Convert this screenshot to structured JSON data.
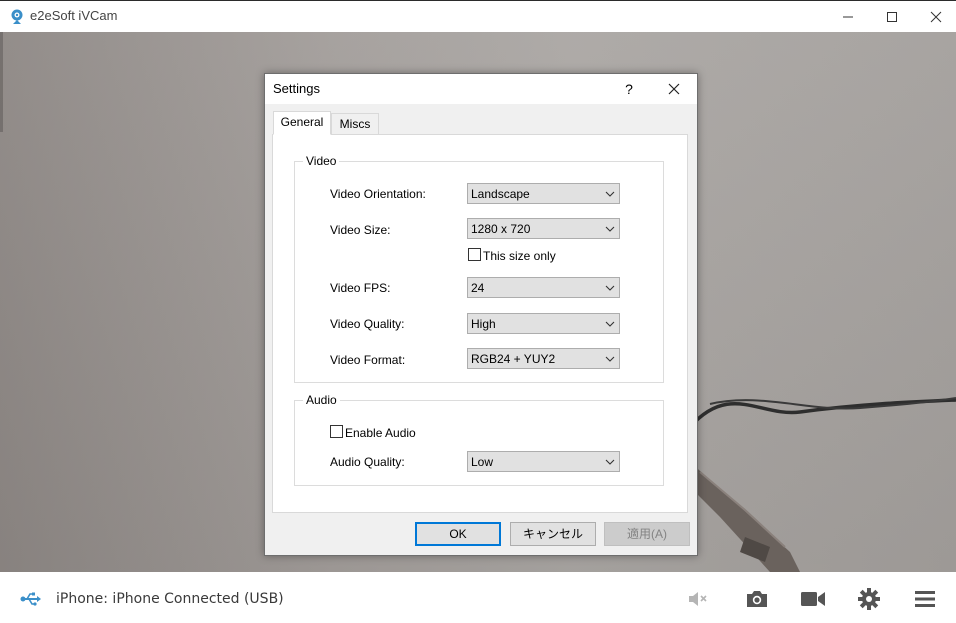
{
  "window": {
    "title": "e2eSoft iVCam",
    "app_icon": "webcam-icon",
    "controls": [
      "minimize-icon",
      "maximize-icon",
      "close-icon"
    ]
  },
  "status": {
    "text": "iPhone: iPhone Connected (USB)",
    "icon": "usb-icon"
  },
  "toolbar": {
    "icons": [
      "mute-icon",
      "camera-icon",
      "video-record-icon",
      "gear-icon",
      "menu-icon"
    ]
  },
  "dialog": {
    "title": "Settings",
    "help": "?",
    "tabs": [
      "General",
      "Miscs"
    ],
    "active_tab": "General",
    "video_group": {
      "label": "Video",
      "orientation_label": "Video Orientation:",
      "orientation_value": "Landscape",
      "size_label": "Video Size:",
      "size_value": "1280 x 720",
      "size_only_label": "This size only",
      "size_only_checked": false,
      "fps_label": "Video FPS:",
      "fps_value": "24",
      "quality_label": "Video Quality:",
      "quality_value": "High",
      "format_label": "Video Format:",
      "format_value": "RGB24 + YUY2"
    },
    "audio_group": {
      "label": "Audio",
      "enable_label": "Enable Audio",
      "enable_checked": false,
      "quality_label": "Audio Quality:",
      "quality_value": "Low"
    },
    "buttons": {
      "ok": "OK",
      "cancel": "キャンセル",
      "apply": "適用(A)"
    }
  },
  "colors": {
    "accent": "#0078d7",
    "icon_blue": "#3a8fc9",
    "toolbar_icon": "#555555"
  }
}
